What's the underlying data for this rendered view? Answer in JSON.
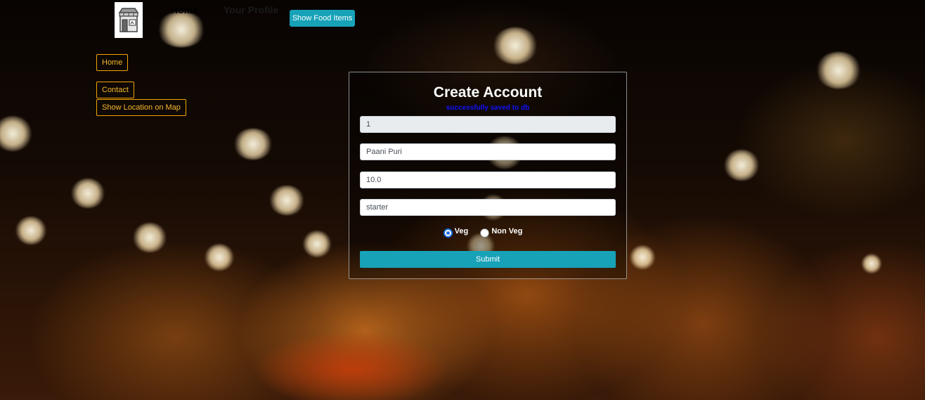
{
  "nav": {
    "logo_icon": "storefront-icon",
    "home_label": "Home",
    "profile_label": "Your Profile",
    "show_food_label": "Show Food Items"
  },
  "sidebar": {
    "items": [
      {
        "label": "Home"
      },
      {
        "label": "Contact"
      },
      {
        "label": "Show Location on Map"
      }
    ]
  },
  "form": {
    "title": "Create Account",
    "message": "successfully saved to db",
    "fields": [
      {
        "value": "1"
      },
      {
        "value": "Paani Puri"
      },
      {
        "value": "10.0"
      },
      {
        "value": "starter"
      }
    ],
    "radio_options": [
      {
        "label": "Veg",
        "checked": true
      },
      {
        "label": "Non Veg",
        "checked": false
      }
    ],
    "submit_label": "Submit"
  },
  "colors": {
    "accent": "#17a2b8",
    "side_button_border": "#f0a500",
    "message": "#1010ff"
  }
}
